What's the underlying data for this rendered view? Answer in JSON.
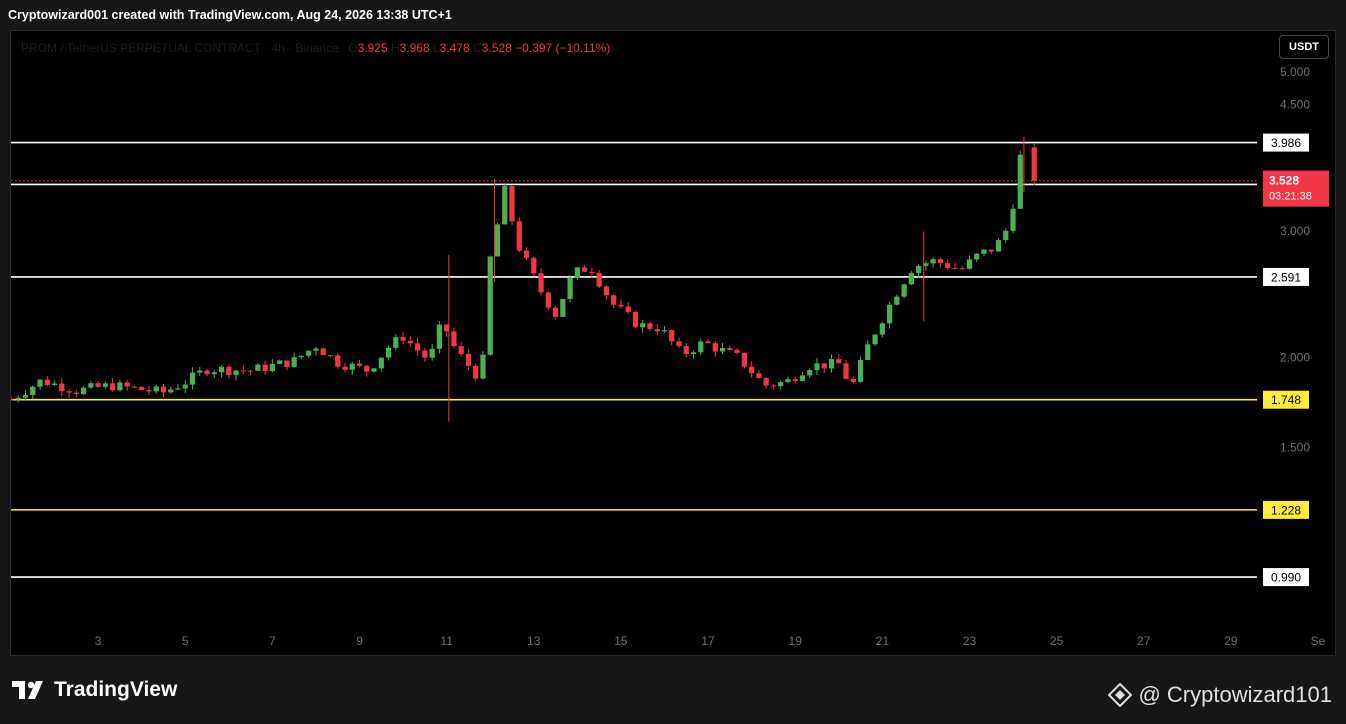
{
  "header": {
    "author_line": "Cryptowizard001 created with TradingView.com, Aug 24, 2026 13:38 UTC+1"
  },
  "legend": {
    "symbol": "PROM / TetherUS PERPETUAL CONTRACT · 4h · Binance",
    "o_label": "O",
    "o_value": "3.925",
    "h_label": "H",
    "h_value": "3.968",
    "l_label": "L",
    "l_value": "3.478",
    "c_label": "C",
    "c_value": "3.528",
    "change": "−0.397 (−10.11%)"
  },
  "currency_button": "USDT",
  "colors": {
    "up": "#26a69a",
    "up_candle": "#4caf50",
    "down": "#f23645",
    "white_level": "#ffffff",
    "yellow_level": "#ffeb3b",
    "grid_text": "#6b6f7a",
    "background": "#000000"
  },
  "chart_data": {
    "type": "candlestick",
    "symbol": "PROM / TetherUS PERPETUAL CONTRACT",
    "timeframe": "4h",
    "exchange": "Binance",
    "y_scale": "log",
    "ylim": [
      0.86,
      5.7
    ],
    "xlim_days": [
      1.0,
      29.6
    ],
    "y_ticks": [
      "5.000",
      "4.500",
      "3.000",
      "2.000",
      "1.500"
    ],
    "y_tick_values": [
      5.0,
      4.5,
      3.0,
      2.0,
      1.5
    ],
    "x_ticks": [
      "3",
      "5",
      "7",
      "9",
      "11",
      "13",
      "15",
      "17",
      "19",
      "21",
      "23",
      "25",
      "27",
      "29",
      "Se"
    ],
    "x_tick_days": [
      3,
      5,
      7,
      9,
      11,
      13,
      15,
      17,
      19,
      21,
      23,
      25,
      27,
      29,
      31
    ],
    "levels": [
      {
        "value": 3.986,
        "label": "3.986",
        "color": "white"
      },
      {
        "value": 3.485,
        "label": "3.485",
        "color": "white"
      },
      {
        "value": 2.591,
        "label": "2.591",
        "color": "white"
      },
      {
        "value": 1.748,
        "label": "1.748",
        "color": "yellow"
      },
      {
        "value": 1.228,
        "label": "1.228",
        "color": "yellow"
      },
      {
        "value": 0.99,
        "label": "0.990",
        "color": "white"
      }
    ],
    "current_price": {
      "value": 3.528,
      "label": "3.528",
      "countdown": "03:21:38"
    },
    "anchors": [
      {
        "day": 1.0,
        "price": 1.75
      },
      {
        "day": 1.7,
        "price": 1.86
      },
      {
        "day": 2.5,
        "price": 1.8
      },
      {
        "day": 3.3,
        "price": 1.83
      },
      {
        "day": 4.5,
        "price": 1.79
      },
      {
        "day": 5.0,
        "price": 1.85
      },
      {
        "day": 5.5,
        "price": 1.93
      },
      {
        "day": 6.5,
        "price": 1.92
      },
      {
        "day": 7.5,
        "price": 1.98
      },
      {
        "day": 8.0,
        "price": 2.08
      },
      {
        "day": 8.5,
        "price": 1.97
      },
      {
        "day": 9.2,
        "price": 1.92
      },
      {
        "day": 9.7,
        "price": 2.08
      },
      {
        "day": 10.0,
        "price": 2.14
      },
      {
        "day": 10.6,
        "price": 1.98
      },
      {
        "day": 10.9,
        "price": 2.25
      },
      {
        "day": 11.2,
        "price": 2.05
      },
      {
        "day": 11.8,
        "price": 1.86
      },
      {
        "day": 12.0,
        "price": 2.75
      },
      {
        "day": 12.35,
        "price": 3.45
      },
      {
        "day": 12.6,
        "price": 2.9
      },
      {
        "day": 13.2,
        "price": 2.45
      },
      {
        "day": 13.5,
        "price": 2.3
      },
      {
        "day": 13.9,
        "price": 2.62
      },
      {
        "day": 14.3,
        "price": 2.68
      },
      {
        "day": 14.8,
        "price": 2.38
      },
      {
        "day": 15.4,
        "price": 2.22
      },
      {
        "day": 15.9,
        "price": 2.2
      },
      {
        "day": 16.4,
        "price": 2.02
      },
      {
        "day": 16.9,
        "price": 2.1
      },
      {
        "day": 17.7,
        "price": 2.0
      },
      {
        "day": 18.3,
        "price": 1.83
      },
      {
        "day": 18.8,
        "price": 1.85
      },
      {
        "day": 19.3,
        "price": 1.95
      },
      {
        "day": 20.0,
        "price": 1.96
      },
      {
        "day": 20.3,
        "price": 1.82
      },
      {
        "day": 20.7,
        "price": 2.1
      },
      {
        "day": 21.3,
        "price": 2.45
      },
      {
        "day": 21.7,
        "price": 2.68
      },
      {
        "day": 22.2,
        "price": 2.73
      },
      {
        "day": 22.8,
        "price": 2.65
      },
      {
        "day": 23.2,
        "price": 2.78
      },
      {
        "day": 23.6,
        "price": 2.85
      },
      {
        "day": 23.9,
        "price": 3.05
      },
      {
        "day": 24.05,
        "price": 3.4
      },
      {
        "day": 24.17,
        "price": 3.82
      },
      {
        "day": 24.32,
        "price": 3.925
      }
    ],
    "last_candle": {
      "open": 3.925,
      "high": 3.968,
      "low": 3.478,
      "close": 3.528
    },
    "spike_wicks": [
      {
        "day": 11.05,
        "high": 2.78,
        "low": 1.63
      },
      {
        "day": 12.1,
        "high": 3.55,
        "low": 2.55
      },
      {
        "day": 21.95,
        "high": 3.0,
        "low": 2.25
      },
      {
        "day": 24.25,
        "high": 4.06,
        "low": 3.4
      }
    ]
  },
  "footer": {
    "brand": "TradingView",
    "handle": "@ Cryptowizard101"
  }
}
